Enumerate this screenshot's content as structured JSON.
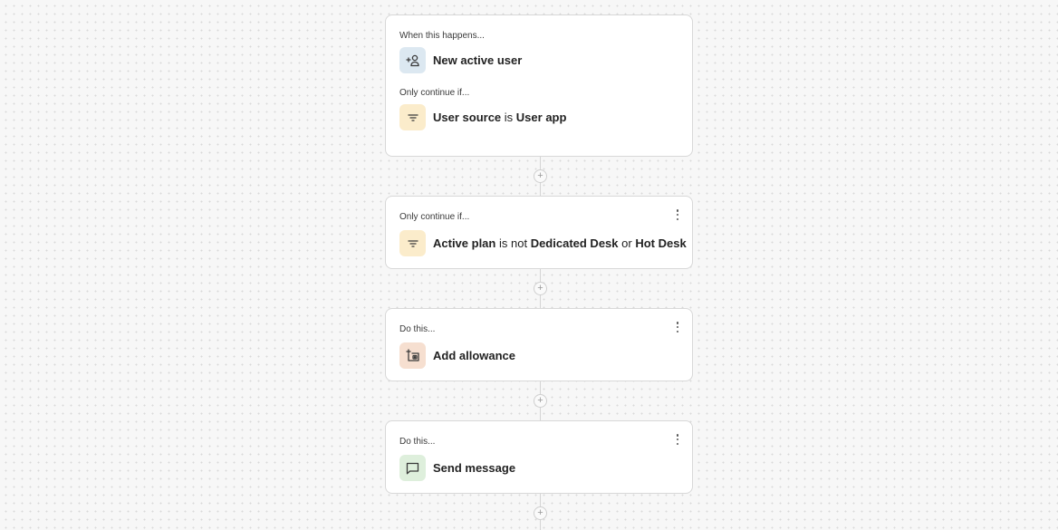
{
  "colors": {
    "trigger_tile": "#dce8f1",
    "filter_tile": "#fbeccb",
    "allowance_tile": "#f6dfd0",
    "message_tile": "#deefdc",
    "icon_stroke": "#3a3a3a"
  },
  "steps": [
    {
      "type": "trigger",
      "label": "When this happens...",
      "title": "New active user",
      "icon": "user-plus-icon",
      "condition": {
        "label": "Only continue if...",
        "field": "User source",
        "operator": "is",
        "value": "User app",
        "icon": "filter-icon"
      }
    },
    {
      "type": "filter",
      "label": "Only continue if...",
      "field": "Active plan",
      "operator": "is not",
      "value1": "Dedicated Desk",
      "joiner": "or",
      "value2": "Hot Desk",
      "icon": "filter-icon",
      "menu": "more-options"
    },
    {
      "type": "action",
      "label": "Do this...",
      "title": "Add allowance",
      "icon": "add-allowance-icon",
      "menu": "more-options"
    },
    {
      "type": "action",
      "label": "Do this...",
      "title": "Send message",
      "icon": "message-icon",
      "menu": "more-options"
    }
  ],
  "add_step_symbol": "+"
}
